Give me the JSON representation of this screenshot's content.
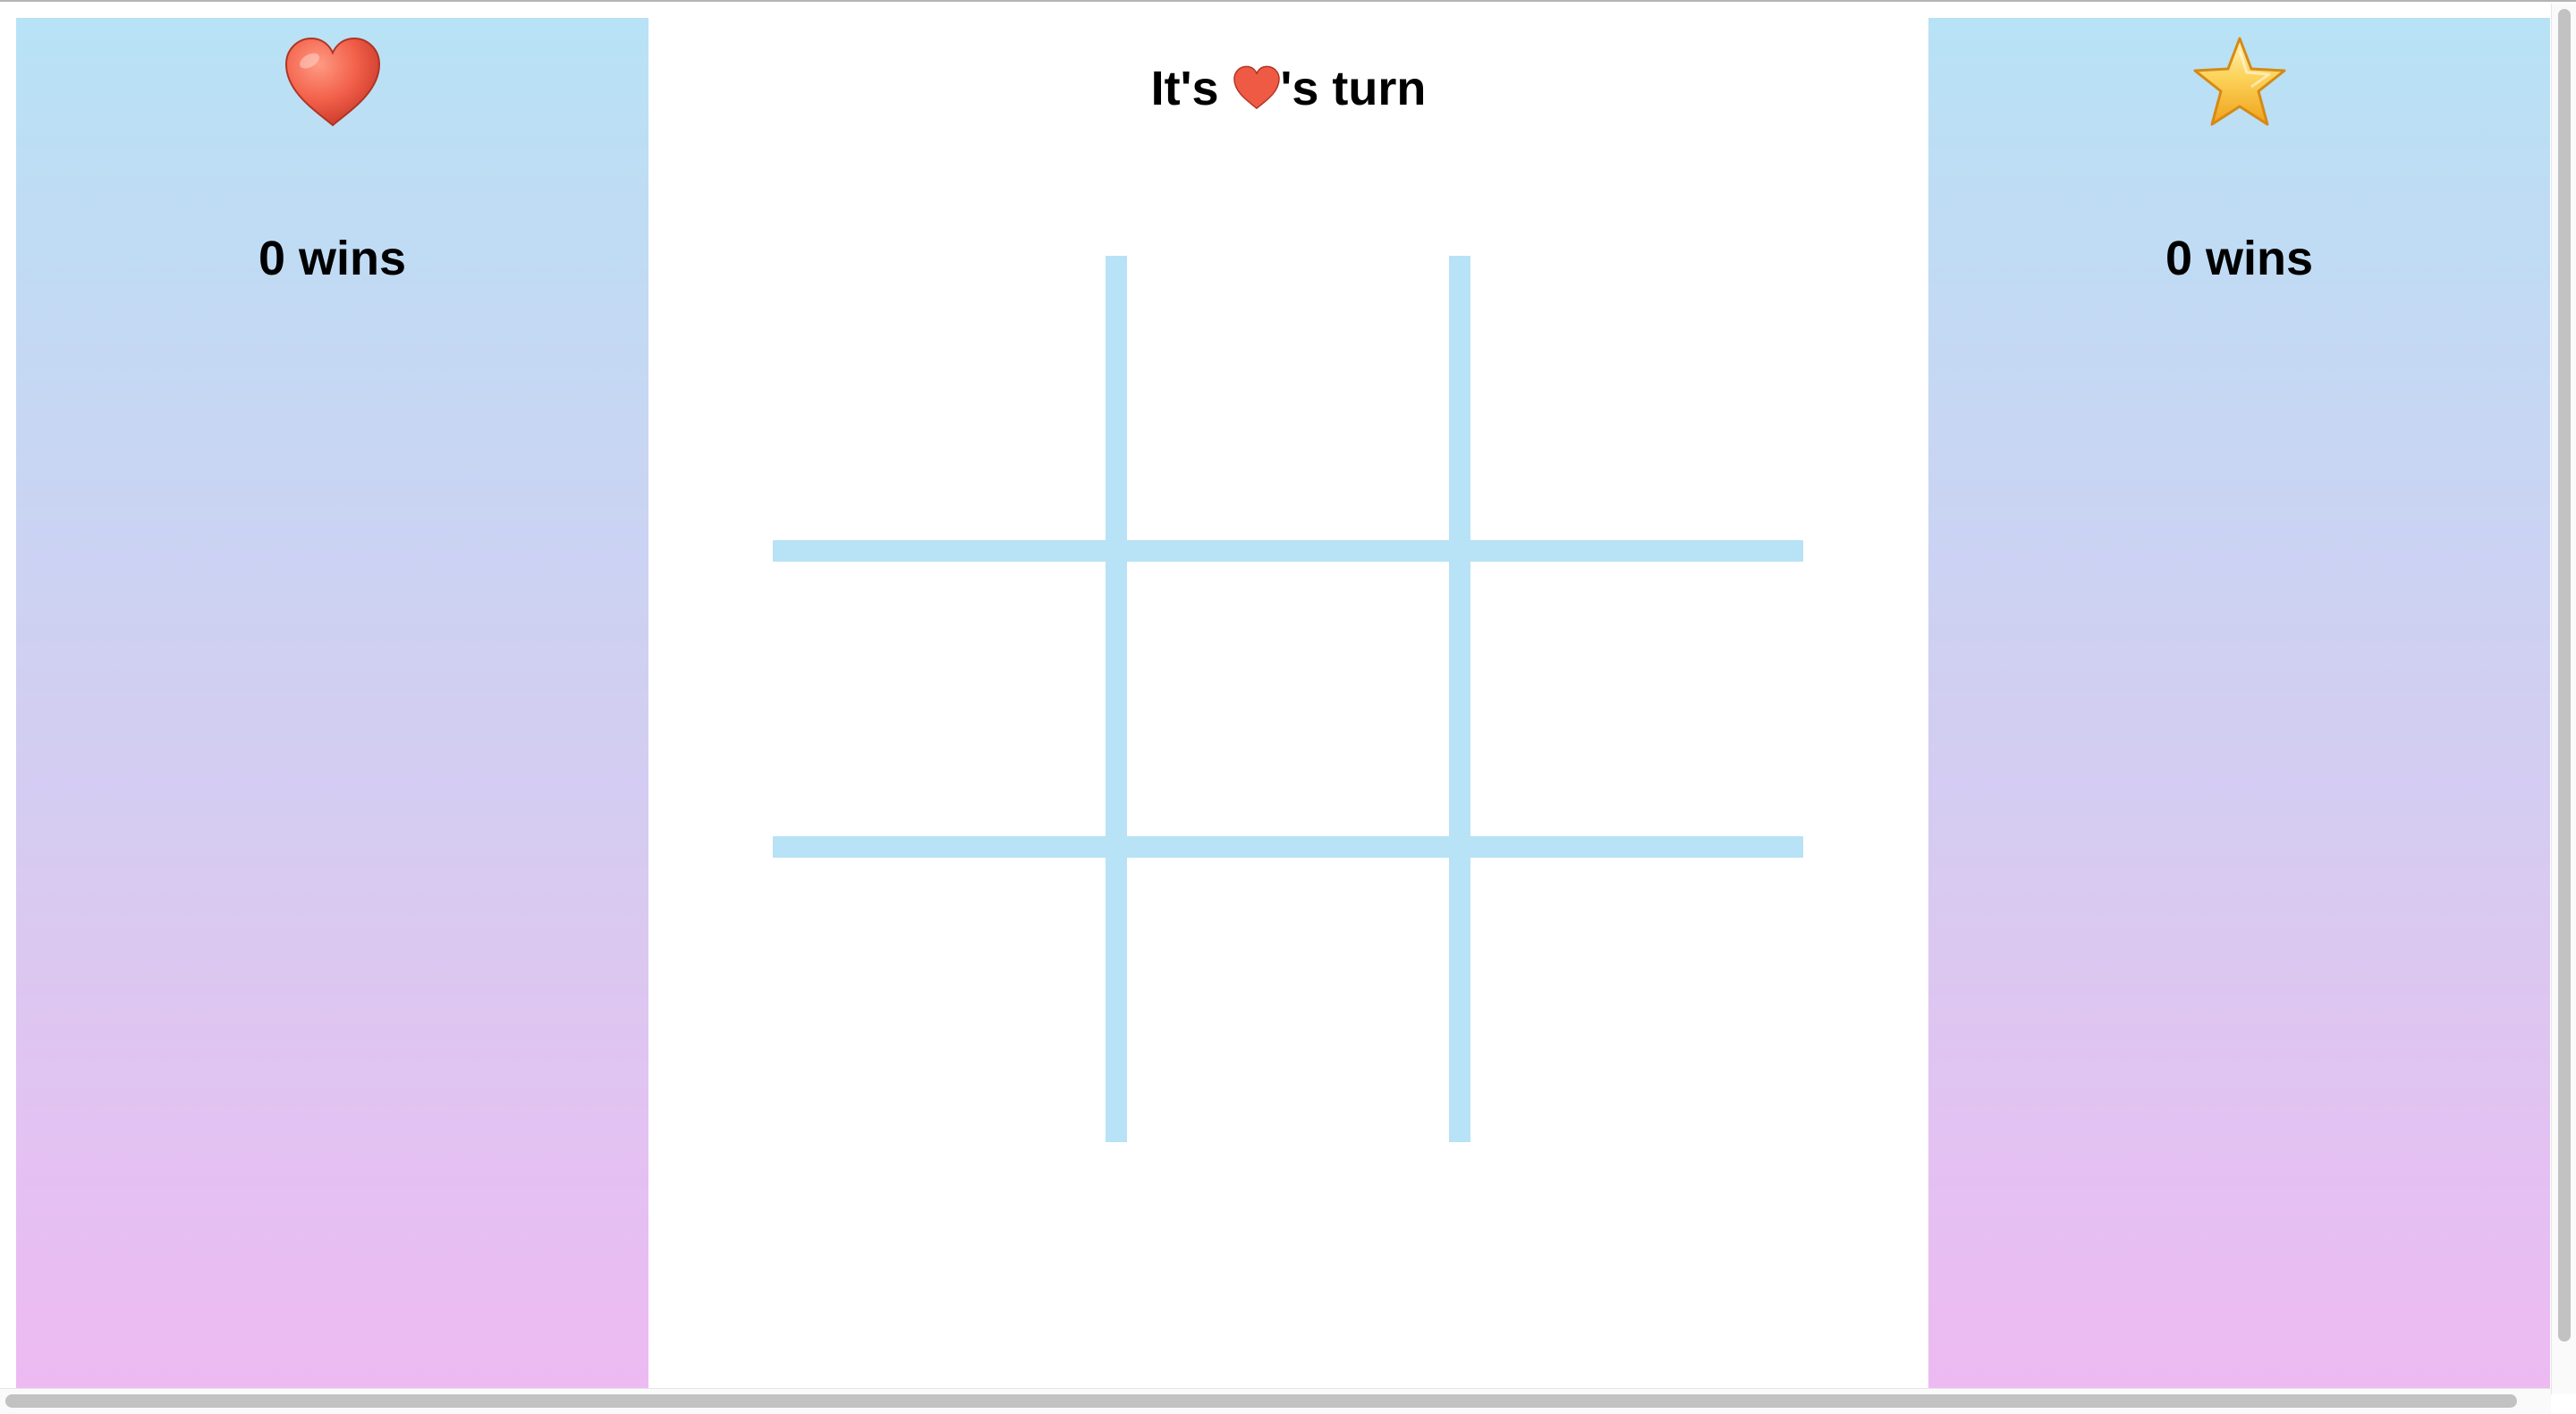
{
  "players": [
    {
      "icon": "heart-icon",
      "glyph": "❤️",
      "wins_text": "0 wins",
      "color": "#e8503c"
    },
    {
      "icon": "star-icon",
      "glyph": "⭐",
      "wins_text": "0 wins",
      "color": "#f5b532"
    }
  ],
  "turn": {
    "prefix": "It's ",
    "current_player_icon": "heart-icon",
    "suffix": "'s turn"
  },
  "board": {
    "cells": [
      "",
      "",
      "",
      "",
      "",
      "",
      "",
      "",
      ""
    ]
  },
  "colors": {
    "grid": "#b8e2f5",
    "panel_top": "#b8e2f5",
    "panel_bottom": "#edbaf2"
  }
}
